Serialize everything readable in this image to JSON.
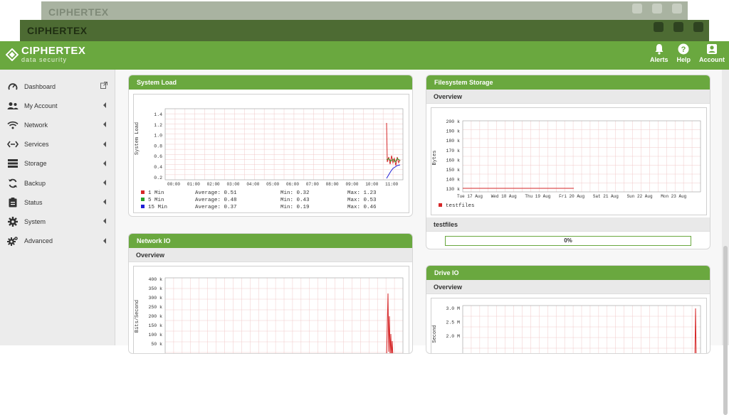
{
  "app": {
    "brand": "CIPHERTEX",
    "tagline": "data security"
  },
  "header": {
    "actions": [
      {
        "label": "Alerts",
        "icon": "bell-icon"
      },
      {
        "label": "Help",
        "icon": "help-icon"
      },
      {
        "label": "Account",
        "icon": "account-icon"
      }
    ]
  },
  "sidebar": {
    "items": [
      {
        "label": "Dashboard",
        "icon": "dashboard-icon"
      },
      {
        "label": "My Account",
        "icon": "users-icon"
      },
      {
        "label": "Network",
        "icon": "wifi-icon"
      },
      {
        "label": "Services",
        "icon": "services-icon"
      },
      {
        "label": "Storage",
        "icon": "storage-icon"
      },
      {
        "label": "Backup",
        "icon": "backup-icon"
      },
      {
        "label": "Status",
        "icon": "status-icon"
      },
      {
        "label": "System",
        "icon": "gear-icon"
      },
      {
        "label": "Advanced",
        "icon": "gears-icon"
      }
    ]
  },
  "system_load": {
    "title": "System Load",
    "ylabel": "System Load",
    "yticks": [
      "1.4",
      "1.2",
      "1.0",
      "0.8",
      "0.6",
      "0.4",
      "0.2"
    ],
    "xticks": [
      "00:00",
      "01:00",
      "02:00",
      "03:00",
      "04:00",
      "05:00",
      "06:00",
      "07:00",
      "08:00",
      "09:00",
      "10:00",
      "11:00"
    ],
    "legend": [
      {
        "name": "1 Min",
        "color": "#d62728",
        "average": "Average: 0.51",
        "min": "Min: 0.32",
        "max": "Max: 1.23"
      },
      {
        "name": "5 Min",
        "color": "#2ca02c",
        "average": "Average: 0.48",
        "min": "Min: 0.43",
        "max": "Max: 0.53"
      },
      {
        "name": "15 Min",
        "color": "#1f1fd6",
        "average": "Average: 0.37",
        "min": "Min: 0.19",
        "max": "Max: 0.46"
      }
    ]
  },
  "filesystem": {
    "title": "Filesystem Storage",
    "overview": "Overview",
    "ylabel": "Bytes",
    "yticks": [
      "200 k",
      "190 k",
      "180 k",
      "170 k",
      "160 k",
      "150 k",
      "140 k",
      "130 k"
    ],
    "xticks": [
      "Tue 17 Aug",
      "Wed 18 Aug",
      "Thu 19 Aug",
      "Fri 20 Aug",
      "Sat 21 Aug",
      "Sun 22 Aug",
      "Mon 23 Aug"
    ],
    "legend": [
      {
        "name": "testfiles",
        "color": "#d62728"
      }
    ],
    "usage_title": "testfiles",
    "usage_percent": 0,
    "usage_label": "0%"
  },
  "network_io": {
    "title": "Network IO",
    "overview": "Overview",
    "ylabel": "Bits/Second",
    "yticks": [
      "400 k",
      "350 k",
      "300 k",
      "250 k",
      "200 k",
      "150 k",
      "100 k",
      "50 k"
    ]
  },
  "drive_io": {
    "title": "Drive IO",
    "overview": "Overview",
    "ylabel": "Second",
    "yticks": [
      "3.0 M",
      "2.5 M",
      "2.0 M"
    ]
  },
  "colors": {
    "brand_green": "#6aa83f",
    "dark_green": "#4d6b33"
  }
}
